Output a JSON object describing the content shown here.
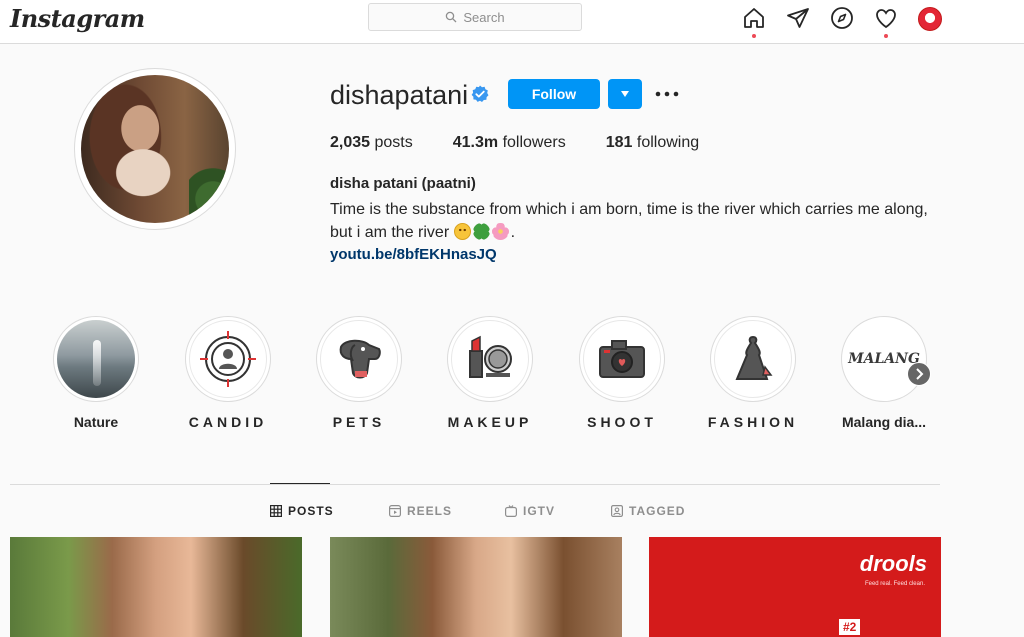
{
  "app": {
    "logo": "Instagram"
  },
  "search": {
    "placeholder": "Search"
  },
  "profile": {
    "username": "dishapatani",
    "follow_label": "Follow",
    "stats": [
      {
        "count": "2,035",
        "label": "posts"
      },
      {
        "count": "41.3m",
        "label": "followers"
      },
      {
        "count": "181",
        "label": "following"
      }
    ],
    "full_name": "disha patani (paatni)",
    "bio_line1": "Time is the substance from which i am born, time is the river which carries me along,",
    "bio_line2": "but i am the river",
    "bio_end": ".",
    "link": "youtu.be/8bfEKHnasJQ"
  },
  "highlights": [
    {
      "label": "Nature"
    },
    {
      "label": "CANDID"
    },
    {
      "label": "PETS"
    },
    {
      "label": "MAKEUP"
    },
    {
      "label": "SHOOT"
    },
    {
      "label": "FASHION"
    },
    {
      "label": "Malang dia..."
    }
  ],
  "highlight_art": {
    "malang": "MALANG"
  },
  "tabs": [
    {
      "label": "POSTS"
    },
    {
      "label": "REELS"
    },
    {
      "label": "IGTV"
    },
    {
      "label": "TAGGED"
    }
  ],
  "posts": {
    "ad_brand": "drools",
    "ad_tagline": "Feed real. Feed clean.",
    "ad_number": "#2"
  },
  "colors": {
    "accent": "#0095f6",
    "notification_dot": "#ed4956",
    "link": "#00376b"
  }
}
